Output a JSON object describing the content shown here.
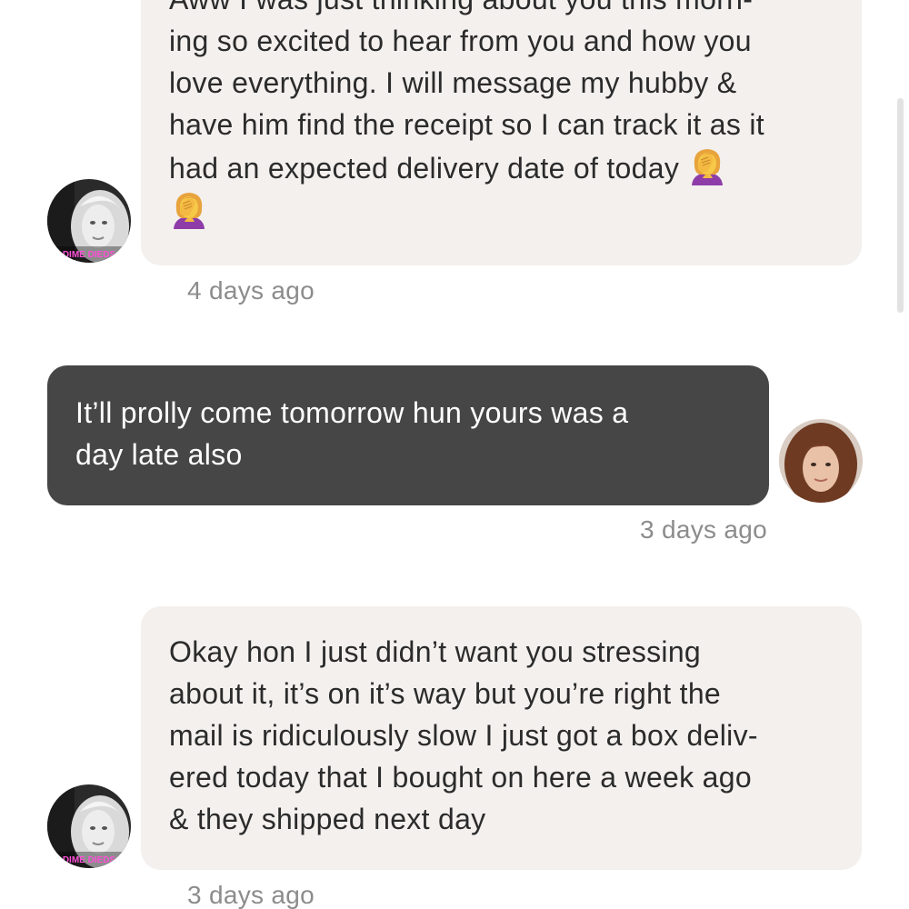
{
  "messages": [
    {
      "sender": "other",
      "lines": [
        "Aww I was just thinking about you this morn-",
        "ing so excited to hear from you and how you",
        "love everything. I will message my hubby &",
        "have him find the receipt so I can track it as it",
        "had an expected delivery date of today"
      ],
      "emojis": [
        "face-palm-emoji",
        "face-palm-emoji"
      ],
      "timestamp": "4 days ago",
      "avatar_caption": "DIME DIEDS"
    },
    {
      "sender": "me",
      "lines": [
        "It’ll prolly come tomorrow hun yours was a",
        "day late also"
      ],
      "timestamp": "3 days ago"
    },
    {
      "sender": "other",
      "lines": [
        "Okay hon I just didn’t want you stressing",
        "about it, it’s on it’s way but you’re right the",
        "mail is ridiculously slow I just got a box deliv-",
        "ered today that I bought on here a week ago",
        "& they shipped next day"
      ],
      "timestamp": "3 days ago",
      "avatar_caption": "DIME DIEDS"
    }
  ],
  "colors": {
    "incoming_bubble": "#f3f0ee",
    "outgoing_bubble": "#464646",
    "timestamp": "#8c8c8c",
    "avatar_caption": "#ff4fd8"
  }
}
